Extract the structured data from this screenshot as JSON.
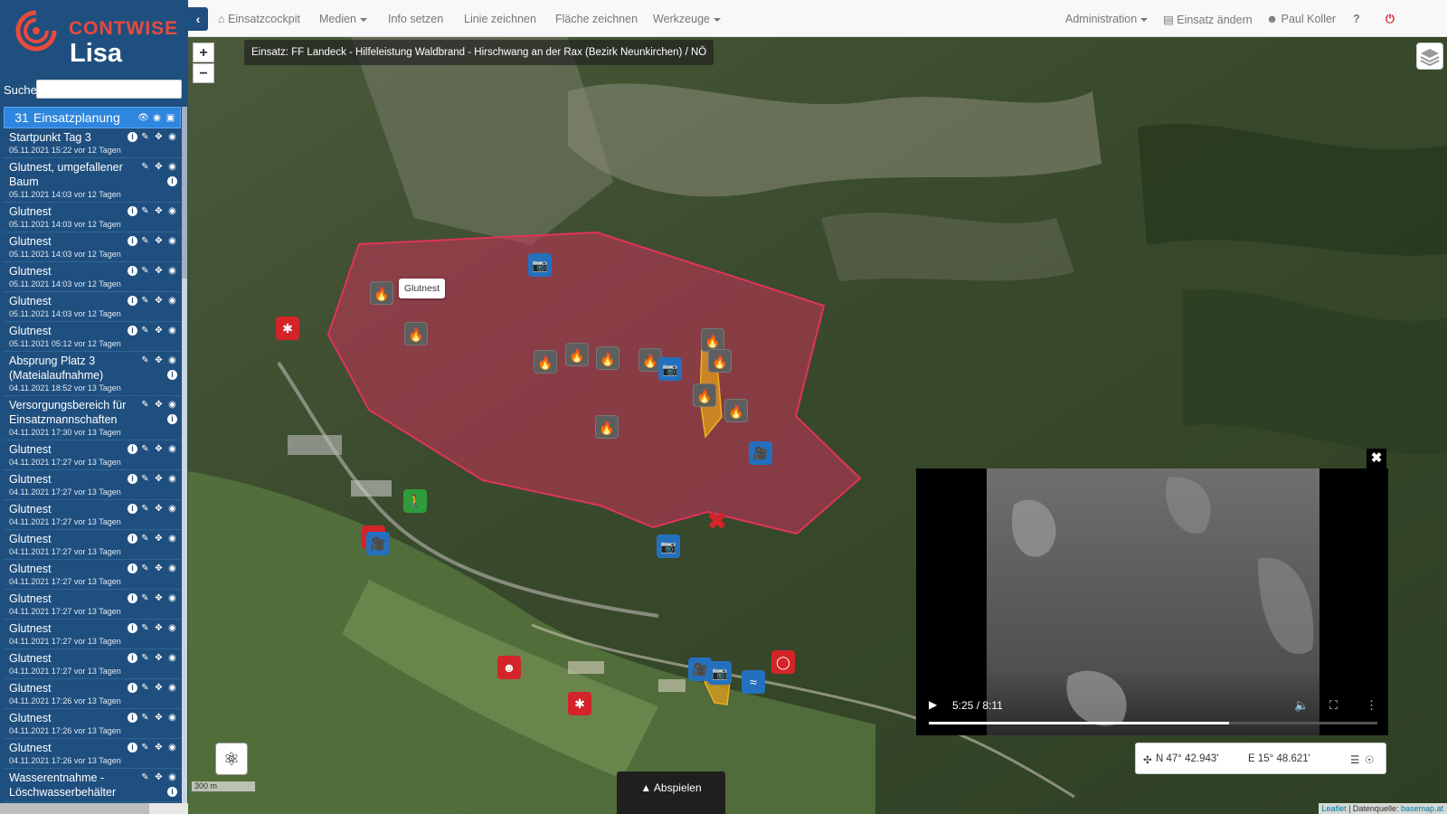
{
  "app": {
    "brand": "CONTWISE",
    "product": "Lisa"
  },
  "search": {
    "label": "Suche",
    "value": "",
    "placeholder": ""
  },
  "category": {
    "count": "31",
    "label": "Einsatzplanung"
  },
  "items": [
    {
      "title": "Startpunkt Tag 3",
      "date": "05.11.2021 15:22 vor 12 Tagen"
    },
    {
      "title": "Glutnest, umgefallener Baum",
      "date": "05.11.2021 14:03 vor 12 Tagen"
    },
    {
      "title": "Glutnest",
      "date": "05.11.2021 14:03 vor 12 Tagen"
    },
    {
      "title": "Glutnest",
      "date": "05.11.2021 14:03 vor 12 Tagen"
    },
    {
      "title": "Glutnest",
      "date": "05.11.2021 14:03 vor 12 Tagen"
    },
    {
      "title": "Glutnest",
      "date": "05.11.2021 14:03 vor 12 Tagen"
    },
    {
      "title": "Glutnest",
      "date": "05.11.2021 05:12 vor 12 Tagen"
    },
    {
      "title": "Absprung Platz 3 (Mateialaufnahme)",
      "date": "04.11.2021 18:52 vor 13 Tagen"
    },
    {
      "title": "Versorgungsbereich für Einsatzmannschaften",
      "date": "04.11.2021 17:30 vor 13 Tagen"
    },
    {
      "title": "Glutnest",
      "date": "04.11.2021 17:27 vor 13 Tagen"
    },
    {
      "title": "Glutnest",
      "date": "04.11.2021 17:27 vor 13 Tagen"
    },
    {
      "title": "Glutnest",
      "date": "04.11.2021 17:27 vor 13 Tagen"
    },
    {
      "title": "Glutnest",
      "date": "04.11.2021 17:27 vor 13 Tagen"
    },
    {
      "title": "Glutnest",
      "date": "04.11.2021 17:27 vor 13 Tagen"
    },
    {
      "title": "Glutnest",
      "date": "04.11.2021 17:27 vor 13 Tagen"
    },
    {
      "title": "Glutnest",
      "date": "04.11.2021 17:27 vor 13 Tagen"
    },
    {
      "title": "Glutnest",
      "date": "04.11.2021 17:27 vor 13 Tagen"
    },
    {
      "title": "Glutnest",
      "date": "04.11.2021 17:26 vor 13 Tagen"
    },
    {
      "title": "Glutnest",
      "date": "04.11.2021 17:26 vor 13 Tagen"
    },
    {
      "title": "Glutnest",
      "date": "04.11.2021 17:26 vor 13 Tagen"
    },
    {
      "title": "Wasserentnahme - Löschwasserbehälter",
      "date": ""
    }
  ],
  "nav": {
    "einsatzcockpit": "Einsatzcockpit",
    "medien": "Medien",
    "info": "Info setzen",
    "linie": "Linie zeichnen",
    "flaeche": "Fläche zeichnen",
    "werkzeuge": "Werkzeuge",
    "administration": "Administration",
    "einsatz_aendern": "Einsatz ändern",
    "user": "Paul Koller"
  },
  "map": {
    "einsatz_title": "Einsatz: FF Landeck - Hilfeleistung Waldbrand - Hirschwang an der Rax (Bezirk Neunkirchen) / NÖ",
    "tooltip": "Glutnest",
    "scale": "300 m",
    "attribution_leaflet": "Leaflet",
    "attribution_sep": " | Datenquelle: ",
    "attribution_source": "basemap.at",
    "abspielen": "Abspielen"
  },
  "video": {
    "time": "5:25 / 8:11",
    "progress": 0.67
  },
  "coords": {
    "lat": "N 47° 42.943'",
    "lon": "E 15° 48.621'"
  },
  "colors": {
    "sidebar": "#1f4f7f",
    "accent": "#2e86de",
    "brand_red": "#e84b3c",
    "fire_area": "#c8325a"
  }
}
